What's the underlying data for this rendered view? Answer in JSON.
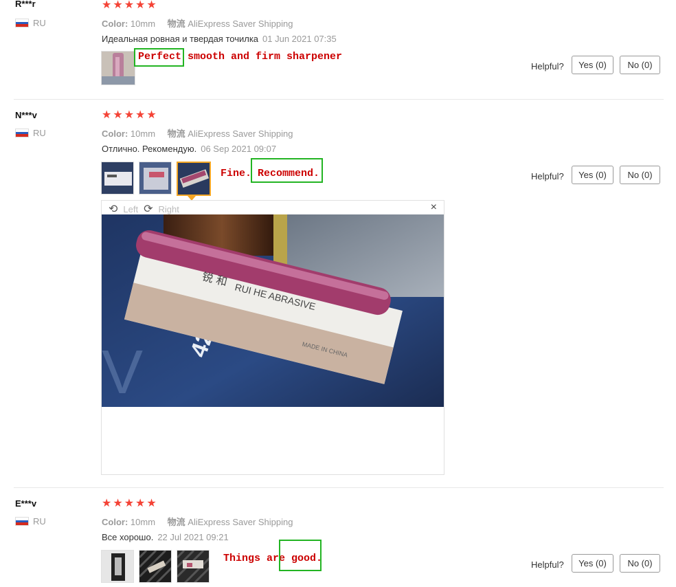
{
  "reviews": [
    {
      "user": "R***r",
      "country": "RU",
      "rating": 5,
      "color_label": "Color:",
      "color_value": "10mm",
      "logistics_label": "物流",
      "logistics_value": "AliExpress Saver Shipping",
      "text": "Идеальная ровная и твердая точилка",
      "date": "01 Jun 2021 07:35",
      "translation": "Perfect smooth and firm sharpener",
      "helpful_label": "Helpful?",
      "yes": "Yes (0)",
      "no": "No (0)"
    },
    {
      "user": "N***v",
      "country": "RU",
      "rating": 5,
      "color_label": "Color:",
      "color_value": "10mm",
      "logistics_label": "物流",
      "logistics_value": "AliExpress Saver Shipping",
      "text": "Отлично. Рекомендую.",
      "date": "06 Sep 2021 09:07",
      "translation": "Fine. Recommend.",
      "helpful_label": "Helpful?",
      "yes": "Yes (0)",
      "no": "No (0)"
    },
    {
      "user": "E***v",
      "country": "RU",
      "rating": 5,
      "color_label": "Color:",
      "color_value": "10mm",
      "logistics_label": "物流",
      "logistics_value": "AliExpress Saver Shipping",
      "text": "Все хорошо.",
      "date": "22 Jul 2021 09:21",
      "translation": "Things are good.",
      "helpful_label": "Helpful?",
      "yes": "Yes (0)",
      "no": "No (0)"
    }
  ],
  "viewer": {
    "left_label": "Left",
    "right_label": "Right",
    "close_symbol": "×",
    "image_text": {
      "brand": "RUI HE ABRASIVE",
      "chinese": "锐 和",
      "made_in": "MADE IN CHINA",
      "number": "42"
    }
  },
  "icons": {
    "star": "★",
    "rotate_left": "⟲",
    "rotate_right": "⟳"
  },
  "colors": {
    "star": "#f44336",
    "translation_text": "#cc0000",
    "highlight_box": "#22b422",
    "active_thumb": "#f5a623"
  }
}
